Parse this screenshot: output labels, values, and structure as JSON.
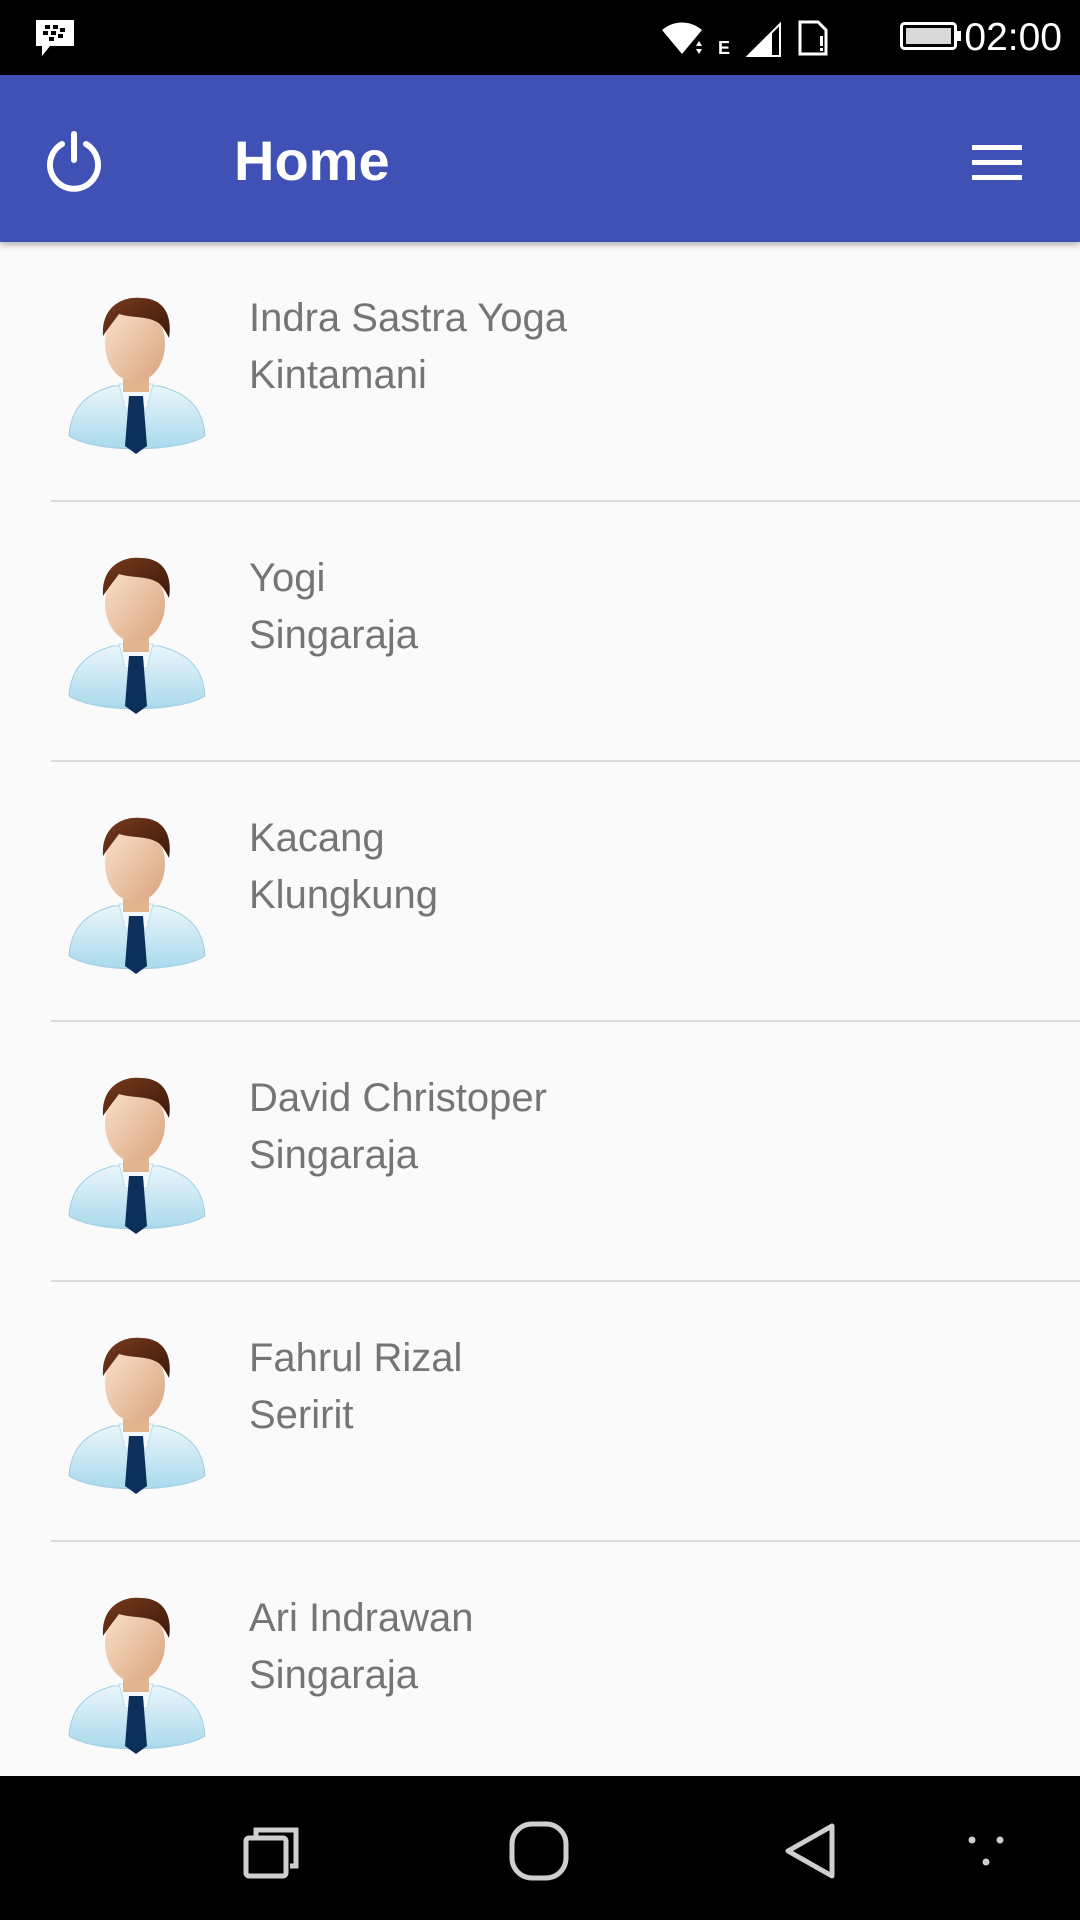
{
  "status_bar": {
    "time": "02:00",
    "icons": [
      "bbm-notification-icon",
      "wifi-icon",
      "mobile-data-icon",
      "signal-icon",
      "sim-icon",
      "battery-icon"
    ]
  },
  "app_bar": {
    "title": "Home",
    "left_icon": "power-icon",
    "right_icon": "menu-icon",
    "background": "#3f51b5"
  },
  "users": [
    {
      "name": "Indra Sastra Yoga",
      "city": "Kintamani"
    },
    {
      "name": "Yogi",
      "city": "Singaraja"
    },
    {
      "name": "Kacang",
      "city": "Klungkung"
    },
    {
      "name": "David Christoper",
      "city": "Singaraja"
    },
    {
      "name": "Fahrul Rizal",
      "city": "Seririt"
    },
    {
      "name": "Ari Indrawan",
      "city": "Singaraja"
    }
  ],
  "nav_bar": {
    "icons": [
      "recents-icon",
      "home-icon",
      "back-icon",
      "more-icon"
    ]
  }
}
